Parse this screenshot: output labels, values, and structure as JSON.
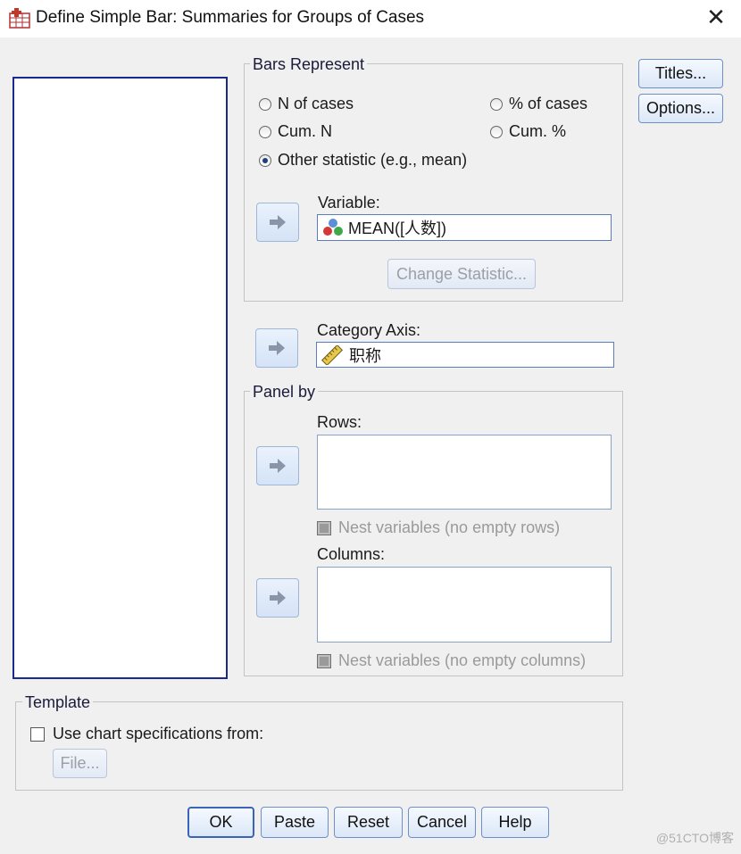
{
  "window": {
    "title": "Define Simple Bar: Summaries for Groups of Cases",
    "close_glyph": "✕"
  },
  "bars_represent": {
    "legend": "Bars Represent",
    "options": [
      {
        "label": "N of cases",
        "selected": false
      },
      {
        "label": "% of cases",
        "selected": false
      },
      {
        "label": "Cum. N",
        "selected": false
      },
      {
        "label": "Cum. %",
        "selected": false
      },
      {
        "label": "Other statistic (e.g., mean)",
        "selected": true
      }
    ],
    "variable_label": "Variable:",
    "variable_value": "MEAN([人数])",
    "change_statistic_label": "Change Statistic..."
  },
  "category_axis": {
    "label": "Category Axis:",
    "value": "职称"
  },
  "panel_by": {
    "legend": "Panel by",
    "rows_label": "Rows:",
    "nest_rows_label": "Nest variables (no empty rows)",
    "columns_label": "Columns:",
    "nest_columns_label": "Nest variables (no empty columns)"
  },
  "template": {
    "legend": "Template",
    "use_spec_label": "Use chart specifications from:",
    "file_label": "File..."
  },
  "side_buttons": {
    "titles": "Titles...",
    "options": "Options..."
  },
  "footer_buttons": {
    "ok": "OK",
    "paste": "Paste",
    "reset": "Reset",
    "cancel": "Cancel",
    "help": "Help"
  },
  "watermark": "@51CTO博客",
  "icons": [
    "app-icon",
    "close-icon",
    "arrow-right-icon",
    "scale-variable-icon",
    "ruler-variable-icon"
  ]
}
